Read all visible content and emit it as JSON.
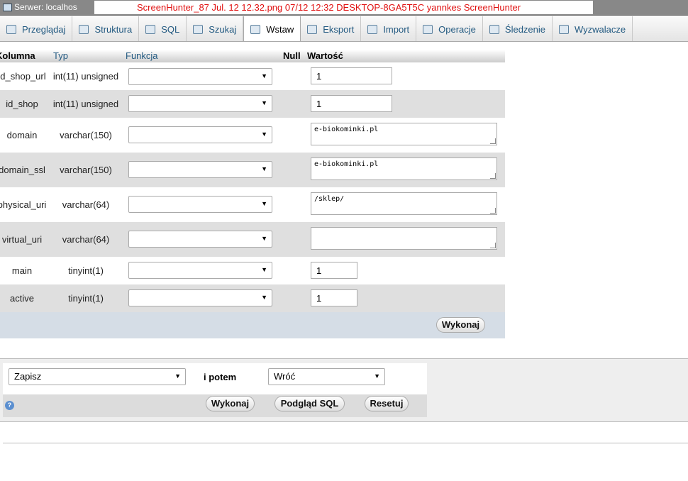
{
  "topbar": {
    "server": "Serwer: localhos",
    "screenhunter": "ScreenHunter_87 Jul. 12 12.32.png  07/12  12:32  DESKTOP-8GA5T5C  yannkes  ScreenHunter"
  },
  "tabs": [
    {
      "label": "Przeglądaj",
      "icon": "browse-icon"
    },
    {
      "label": "Struktura",
      "icon": "structure-icon"
    },
    {
      "label": "SQL",
      "icon": "sql-icon"
    },
    {
      "label": "Szukaj",
      "icon": "search-icon"
    },
    {
      "label": "Wstaw",
      "icon": "insert-icon"
    },
    {
      "label": "Eksport",
      "icon": "export-icon"
    },
    {
      "label": "Import",
      "icon": "import-icon"
    },
    {
      "label": "Operacje",
      "icon": "wrench-icon"
    },
    {
      "label": "Śledzenie",
      "icon": "eye-icon"
    },
    {
      "label": "Wyzwalacze",
      "icon": "triggers-icon"
    }
  ],
  "table": {
    "headers": {
      "column": "Kolumna",
      "type": "Typ",
      "function": "Funkcja",
      "null": "Null",
      "value": "Wartość"
    },
    "rows": [
      {
        "column": "id_shop_url",
        "type": "int(11) unsigned",
        "value": "1"
      },
      {
        "column": "id_shop",
        "type": "int(11) unsigned",
        "value": "1"
      },
      {
        "column": "domain",
        "type": "varchar(150)",
        "value": "e-biokominki.pl"
      },
      {
        "column": "domain_ssl",
        "type": "varchar(150)",
        "value": "e-biokominki.pl"
      },
      {
        "column": "physical_uri",
        "type": "varchar(64)",
        "value": "/sklep/"
      },
      {
        "column": "virtual_uri",
        "type": "varchar(64)",
        "value": ""
      },
      {
        "column": "main",
        "type": "tinyint(1)",
        "value": "1"
      },
      {
        "column": "active",
        "type": "tinyint(1)",
        "value": "1"
      }
    ],
    "execute_label": "Wykonaj"
  },
  "bottom": {
    "action_select": "Zapisz",
    "then_label": "i potem",
    "then_select": "Wróć",
    "execute_label": "Wykonaj",
    "preview_label": "Podgląd SQL",
    "reset_label": "Resetuj",
    "help_icon": "?"
  }
}
